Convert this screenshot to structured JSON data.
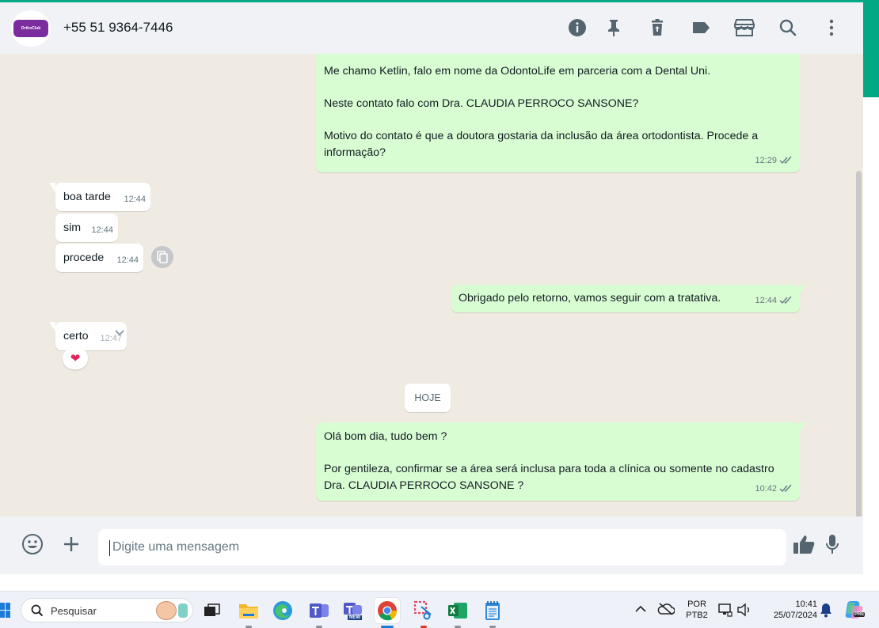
{
  "header": {
    "avatar_text": "OrthoClub",
    "contact_name": "+55 51 9364-7446",
    "icons": [
      "info-icon",
      "pin-icon",
      "delete-icon",
      "label-icon",
      "store-icon",
      "search-icon",
      "more-icon"
    ]
  },
  "messages": [
    {
      "direction": "out",
      "text": "Me chamo Ketlin, falo em nome da OdontoLife em parceria com a Dental Uni.\n\nNeste contato falo com Dra. CLAUDIA PERROCO SANSONE?\n\nMotivo do contato é que a doutora gostaria da inclusão da área ortodontista. Procede a informação?",
      "time": "12:29",
      "status": "read"
    },
    {
      "direction": "in",
      "text": "boa tarde",
      "time": "12:44"
    },
    {
      "direction": "in",
      "text": "sim",
      "time": "12:44"
    },
    {
      "direction": "in",
      "text": "procede",
      "time": "12:44"
    },
    {
      "direction": "out",
      "text": "Obrigado pelo retorno, vamos seguir com a tratativa.",
      "time": "12:44",
      "status": "read"
    },
    {
      "direction": "in",
      "text": "certo",
      "time": "12:47",
      "reaction": "❤"
    },
    {
      "direction": "out",
      "text": "Olá bom dia, tudo bem ?\n\nPor gentileza, confirmar se a área será inclusa para toda a clínica ou somente no cadastro Dra. CLAUDIA PERROCO SANSONE ?",
      "time": "10:42",
      "status": "read"
    }
  ],
  "date_divider": "HOJE",
  "composer": {
    "placeholder": "Digite uma mensagem"
  },
  "taskbar": {
    "search_label": "Pesquisar",
    "apps": [
      "file-explorer",
      "edge",
      "teams",
      "teams-new",
      "chrome",
      "snipping-tool",
      "excel",
      "notepad"
    ],
    "teams_new_badge": "NEW",
    "language": "POR",
    "keyboard": "PTB2",
    "time": "10:41",
    "date": "25/07/2024",
    "copilot_badge": "PRE"
  },
  "colors": {
    "accent": "#00a884",
    "outgoing": "#d9fdd3",
    "incoming": "#ffffff",
    "chat_bg": "#efeae2",
    "read_ticks": "#667781"
  }
}
